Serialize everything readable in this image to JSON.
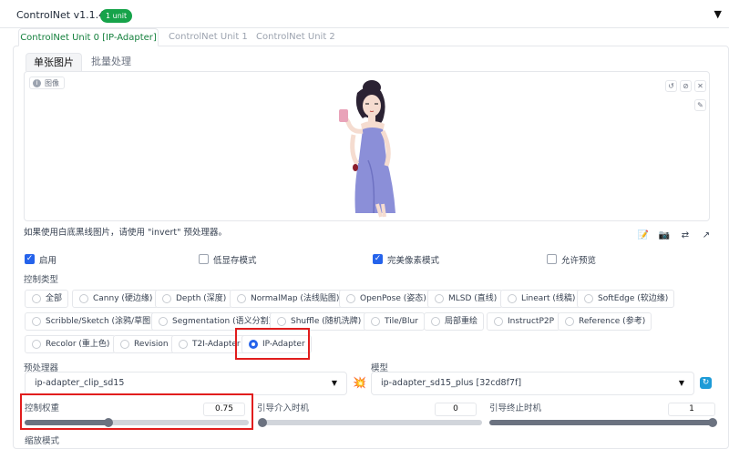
{
  "header": {
    "title": "ControlNet v1.1.411",
    "badge": "1 unit",
    "collapse_glyph": "▼"
  },
  "unit_tabs": [
    "ControlNet Unit 0 [IP-Adapter]",
    "ControlNet Unit 1",
    "ControlNet Unit 2"
  ],
  "image_tabs": [
    "单张图片",
    "批量处理"
  ],
  "image": {
    "label": "图像",
    "tools": [
      "↺",
      "⊘",
      "✕"
    ],
    "brush": "✎"
  },
  "hint": "如果使用白底黑线图片，请使用 \"invert\" 预处理器。",
  "tool_icons": [
    "📝",
    "📷",
    "⇄",
    "↗"
  ],
  "checkboxes": [
    {
      "label": "启用",
      "checked": true
    },
    {
      "label": "低显存模式",
      "checked": false
    },
    {
      "label": "完美像素模式",
      "checked": true
    },
    {
      "label": "允许预览",
      "checked": false
    }
  ],
  "control_type": {
    "label": "控制类型",
    "options": [
      "全部",
      "Canny (硬边缘)",
      "Depth (深度)",
      "NormalMap (法线贴图)",
      "OpenPose (姿态)",
      "MLSD (直线)",
      "Lineart (线稿)",
      "SoftEdge (软边缘)",
      "Scribble/Sketch (涂鸦/草图)",
      "Segmentation (语义分割)",
      "Shuffle (随机洗牌)",
      "Tile/Blur",
      "局部重绘",
      "InstructP2P",
      "Reference (参考)",
      "Recolor (重上色)",
      "Revision",
      "T2I-Adapter",
      "IP-Adapter"
    ],
    "selected": "IP-Adapter"
  },
  "preprocessor": {
    "label": "预处理器",
    "value": "ip-adapter_clip_sd15"
  },
  "model": {
    "label": "模型",
    "value": "ip-adapter_sd15_plus [32cd8f7f]"
  },
  "sliders": {
    "weight": {
      "label": "控制权重",
      "value": "0.75",
      "fraction": 0.375
    },
    "start": {
      "label": "引导介入时机",
      "value": "0",
      "fraction": 0
    },
    "end": {
      "label": "引导终止时机",
      "value": "1",
      "fraction": 1
    }
  },
  "resize_mode": {
    "label": "缩放模式"
  },
  "colors": {
    "accent": "#2563eb",
    "badge": "#16a34a",
    "highlight": "#e11d1d",
    "active_tab": "#15803d"
  }
}
